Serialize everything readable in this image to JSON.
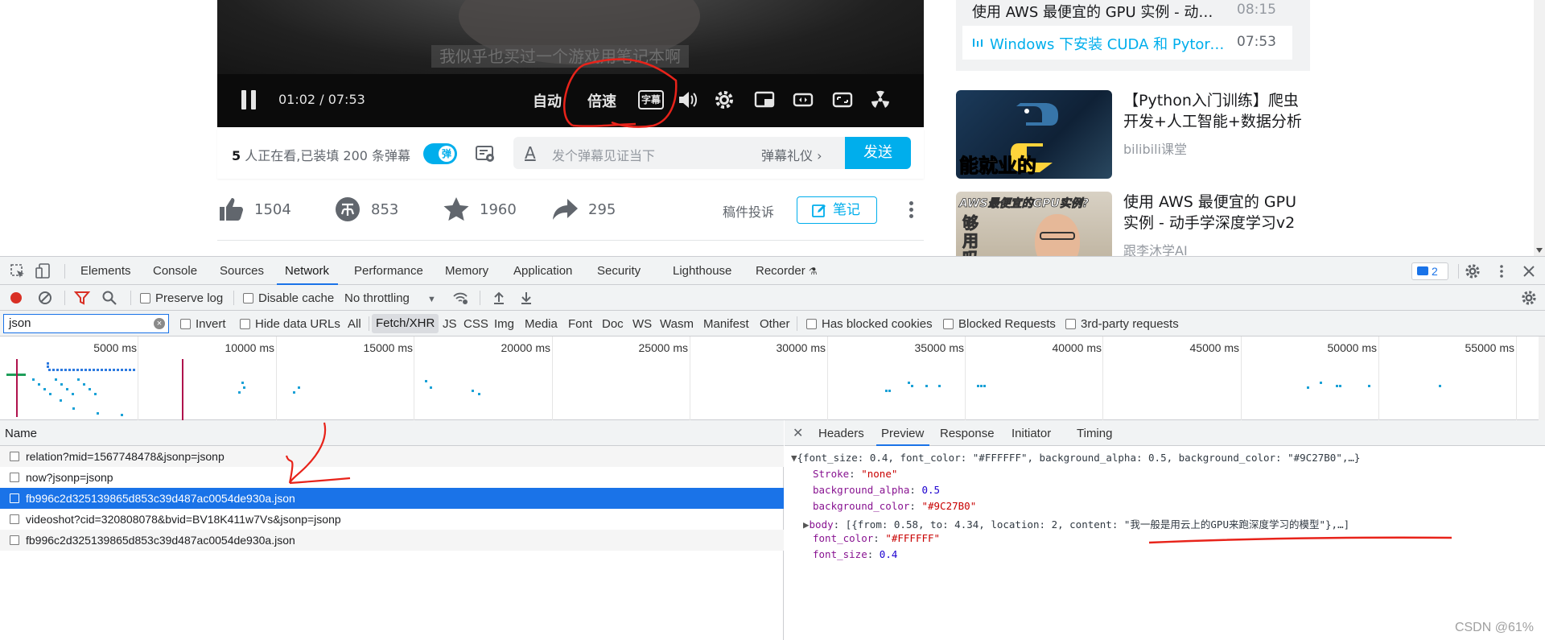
{
  "video": {
    "subtitle": "我似乎也买过一个游戏用笔记本啊",
    "time_current": "01:02",
    "time_separator": "/",
    "time_total": "07:53",
    "auto_label": "自动",
    "speed_label": "倍速",
    "subtitle_btn_label": "字幕",
    "icons": [
      "volume-icon",
      "settings-icon",
      "pip-icon",
      "widescreen-icon",
      "fullscreen-icon",
      "radiation-icon"
    ]
  },
  "danmaku": {
    "viewers_count": "5",
    "viewers_text": " 人正在看,已装填 200 条弹幕",
    "toggle_label": "弹",
    "a_glyph": "A",
    "input_placeholder": "发个弹幕见证当下",
    "etiquette": "弹幕礼仪 ›",
    "send": "发送"
  },
  "actions": {
    "like": "1504",
    "coin": "853",
    "favorite": "1960",
    "share": "295",
    "report": "稿件投诉",
    "note": "笔记"
  },
  "playlist": [
    {
      "title": "使用 AWS 最便宜的 GPU 实例 - 动…",
      "duration": "08:15",
      "active": false
    },
    {
      "title": "Windows 下安装 CUDA 和 Pytorc…",
      "duration": "07:53",
      "active": true
    }
  ],
  "recommended": [
    {
      "title": "【Python入门训练】爬虫开发+人工智能+数据分析",
      "uploader": "bilibili课堂",
      "thumb_text": "能就业的Python"
    },
    {
      "title": "使用 AWS 最便宜的 GPU 实例 - 动手学深度学习v2",
      "uploader": "跟李沐学AI",
      "thumb_text": "AWS最便宜的GPU实例?",
      "thumb_text2": "够用吗"
    }
  ],
  "devtools": {
    "tabs": [
      "Elements",
      "Console",
      "Sources",
      "Network",
      "Performance",
      "Memory",
      "Application",
      "Security",
      "Lighthouse",
      "Recorder"
    ],
    "active_tab": "Network",
    "issues_count": "2",
    "toolbar": {
      "preserve_log": "Preserve log",
      "disable_cache": "Disable cache",
      "throttling": "No throttling"
    },
    "filter": {
      "value": "json",
      "invert": "Invert",
      "hide_data_urls": "Hide data URLs",
      "types": [
        "All",
        "Fetch/XHR",
        "JS",
        "CSS",
        "Img",
        "Media",
        "Font",
        "Doc",
        "WS",
        "Wasm",
        "Manifest",
        "Other"
      ],
      "active_type": "Fetch/XHR",
      "has_blocked_cookies": "Has blocked cookies",
      "blocked_requests": "Blocked Requests",
      "third_party": "3rd-party requests"
    },
    "timeline_labels": [
      "5000 ms",
      "10000 ms",
      "15000 ms",
      "20000 ms",
      "25000 ms",
      "30000 ms",
      "35000 ms",
      "40000 ms",
      "45000 ms",
      "50000 ms",
      "55000 ms"
    ],
    "requests_header": "Name",
    "requests": [
      {
        "name": "relation?mid=1567748478&jsonp=jsonp",
        "selected": false
      },
      {
        "name": "now?jsonp=jsonp",
        "selected": false
      },
      {
        "name": "fb996c2d325139865d853c39d487ac0054de930a.json",
        "selected": true
      },
      {
        "name": "videoshot?cid=320808078&bvid=BV18K411w7Vs&jsonp=jsonp",
        "selected": false
      },
      {
        "name": "fb996c2d325139865d853c39d487ac0054de930a.json",
        "selected": false
      }
    ],
    "preview_tabs": [
      "Headers",
      "Preview",
      "Response",
      "Initiator",
      "Timing"
    ],
    "active_preview_tab": "Preview",
    "preview": {
      "summary": "{font_size: 0.4, font_color: \"#FFFFFF\", background_alpha: 0.5, background_color: \"#9C27B0\",…}",
      "stroke_key": "Stroke",
      "stroke_val": "\"none\"",
      "bg_alpha_key": "background_alpha",
      "bg_alpha_val": "0.5",
      "bg_color_key": "background_color",
      "bg_color_val": "\"#9C27B0\"",
      "body_key": "body",
      "body_val": "[{from: 0.58, to: 4.34, location: 2, content: \"我一般是用云上的GPU来跑深度学习的模型\"},…]",
      "font_color_key": "font_color",
      "font_color_val": "\"#FFFFFF\"",
      "font_size_key": "font_size",
      "font_size_val": "0.4"
    },
    "watermark": "CSDN @61%"
  },
  "colors": {
    "bili_blue": "#00aeec",
    "devtools_blue": "#1a73e8",
    "annotation_red": "#e8231a"
  }
}
